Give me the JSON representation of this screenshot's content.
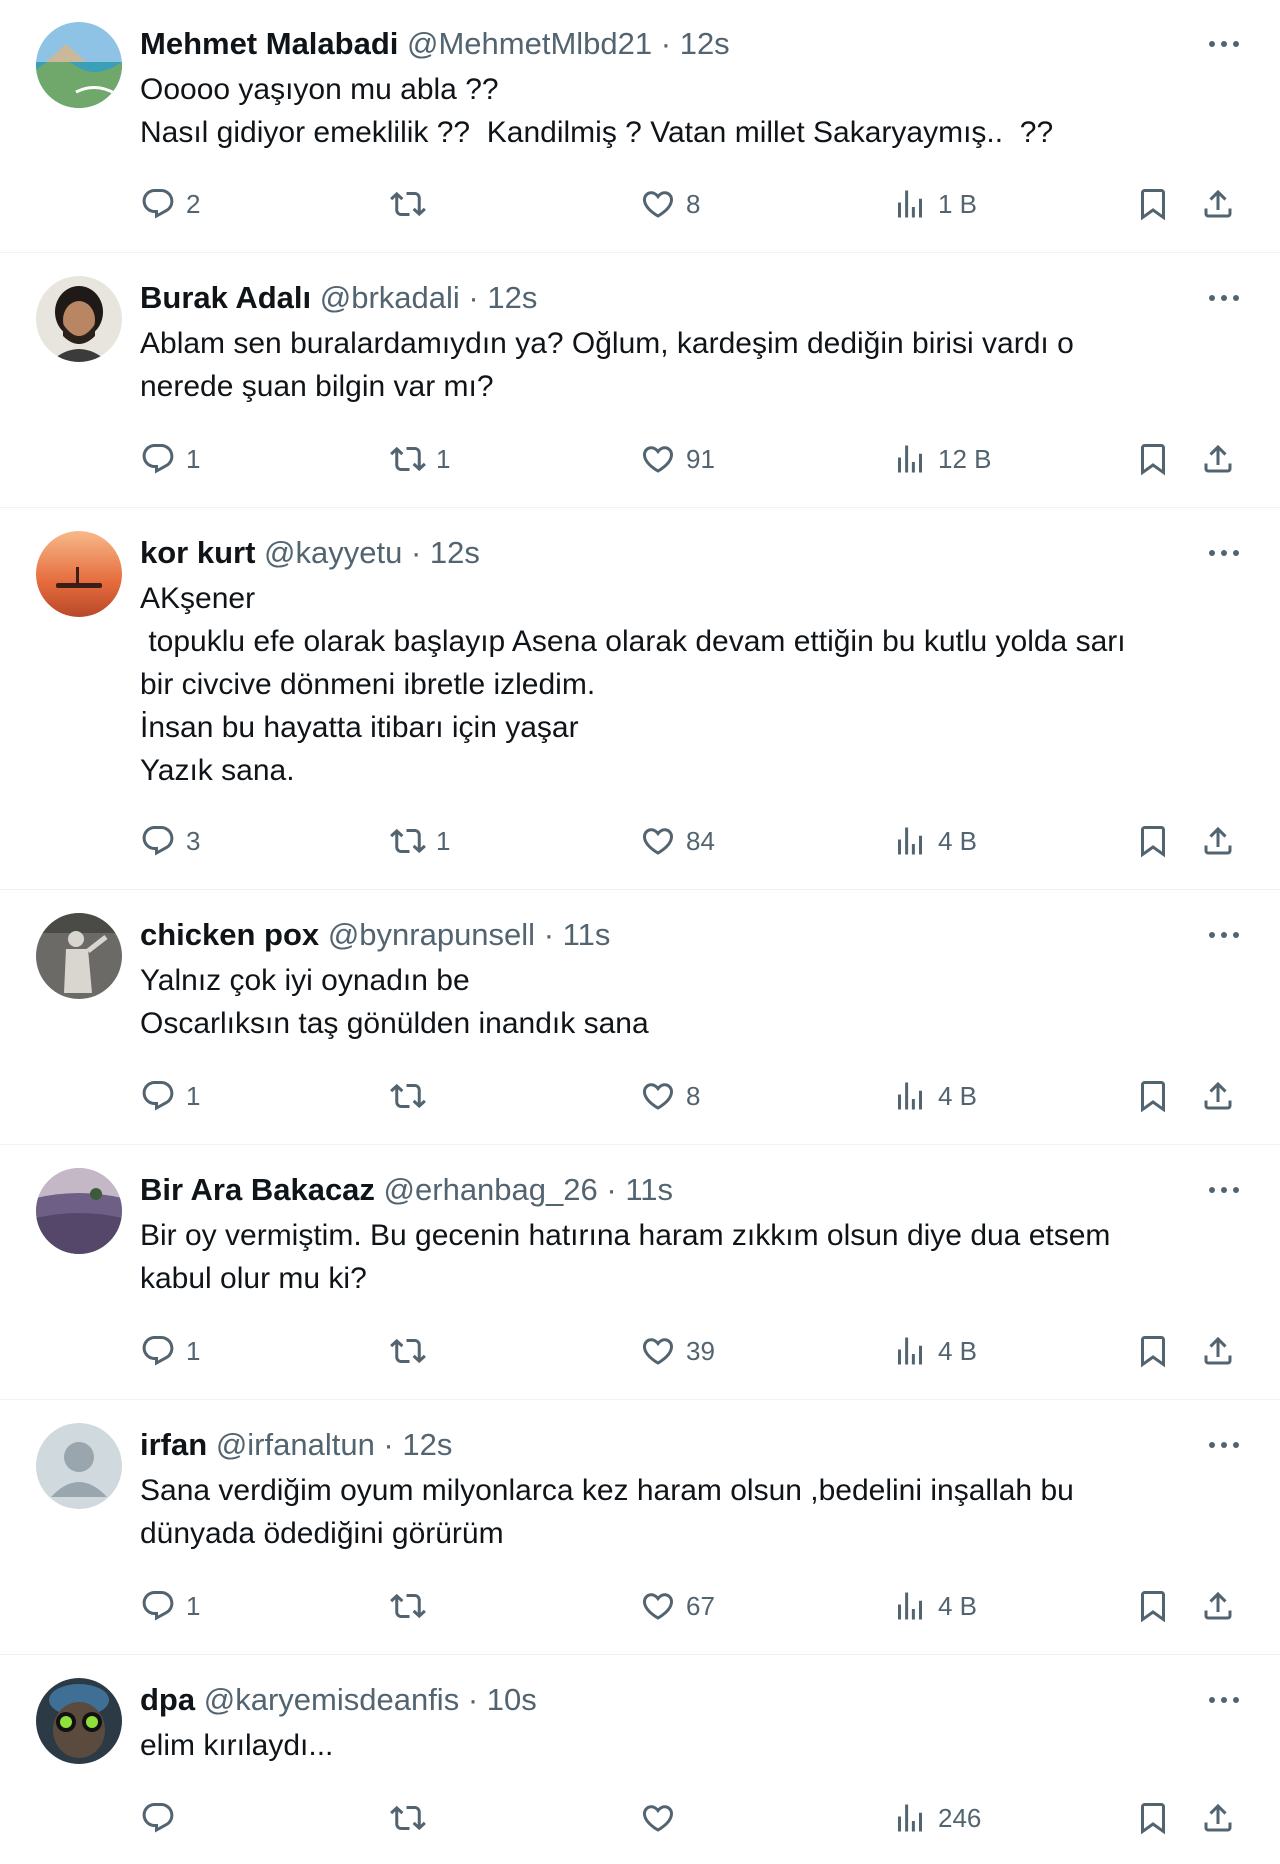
{
  "tweets": [
    {
      "name": "Mehmet Malabadi",
      "handle": "@MehmetMlbd21",
      "sep": " · ",
      "time": "12s",
      "lines": [
        "Ooooo yaşıyon mu abla ??",
        "Nasıl gidiyor emeklilik ??  Kandilmiş ? Vatan millet Sakaryaymış..  ??"
      ],
      "replies": "2",
      "retweets": "",
      "likes": "8",
      "views": "1 B",
      "avatar": "landscape"
    },
    {
      "name": "Burak Adalı",
      "handle": "@brkadali",
      "sep": " · ",
      "time": "12s",
      "lines": [
        "Ablam sen buralardamıydın ya? Oğlum, kardeşim dediğin birisi vardı o",
        "nerede şuan bilgin var mı?"
      ],
      "replies": "1",
      "retweets": "1",
      "likes": "91",
      "views": "12 B",
      "avatar": "person-dark"
    },
    {
      "name": "kor kurt",
      "handle": "@kayyetu",
      "sep": " · ",
      "time": "12s",
      "lines": [
        "AKşener",
        " topuklu efe olarak başlayıp Asena olarak devam ettiğin bu kutlu yolda sarı",
        "bir civcive dönmeni ibretle izledim.",
        "İnsan bu hayatta itibarı için yaşar",
        "Yazık sana."
      ],
      "replies": "3",
      "retweets": "1",
      "likes": "84",
      "views": "4 B",
      "avatar": "sunset"
    },
    {
      "name": "chicken pox",
      "handle": "@bynrapunsell",
      "sep": " · ",
      "time": "11s",
      "lines": [
        "Yalnız çok iyi oynadın be",
        "Oscarlıksın taş gönülden inandık sana"
      ],
      "replies": "1",
      "retweets": "",
      "likes": "8",
      "views": "4 B",
      "avatar": "statue"
    },
    {
      "name": "Bir Ara Bakacaz",
      "handle": "@erhanbag_26",
      "sep": " · ",
      "time": "11s",
      "lines": [
        "Bir oy vermiştim. Bu gecenin hatırına haram zıkkım olsun diye dua etsem",
        "kabul olur mu ki?"
      ],
      "replies": "1",
      "retweets": "",
      "likes": "39",
      "views": "4 B",
      "avatar": "field"
    },
    {
      "name": "irfan",
      "handle": "@irfanaltun",
      "sep": " · ",
      "time": "12s",
      "lines": [
        "Sana verdiğim oyum milyonlarca kez haram olsun ,bedelini inşallah bu",
        "dünyada ödediğini görürüm"
      ],
      "replies": "1",
      "retweets": "",
      "likes": "67",
      "views": "4 B",
      "avatar": "default"
    },
    {
      "name": "dpa",
      "handle": "@karyemisdeanfis",
      "sep": " · ",
      "time": "10s",
      "lines": [
        "elim kırılaydı..."
      ],
      "replies": "",
      "retweets": "",
      "likes": "",
      "views": "246",
      "avatar": "goggles"
    }
  ],
  "colors": {
    "text": "#0f1419",
    "muted": "#536471",
    "divider": "#eff3f4"
  },
  "icons": [
    "reply-icon",
    "retweet-icon",
    "like-icon",
    "views-icon",
    "bookmark-icon",
    "share-icon",
    "more-icon"
  ]
}
